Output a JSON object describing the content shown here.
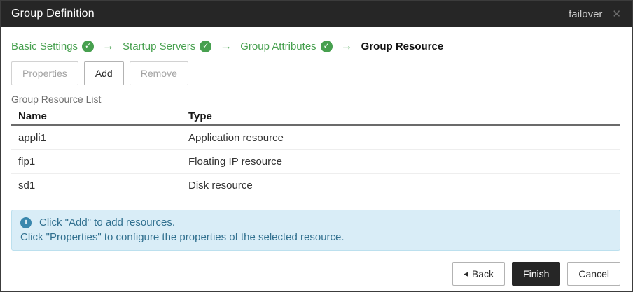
{
  "dialog": {
    "title": "Group Definition",
    "context_label": "failover",
    "close_glyph": "✕"
  },
  "wizard": {
    "check_glyph": "✓",
    "arrow_glyph": "→",
    "steps": [
      {
        "label": "Basic Settings",
        "completed": true,
        "current": false
      },
      {
        "label": "Startup Servers",
        "completed": true,
        "current": false
      },
      {
        "label": "Group Attributes",
        "completed": true,
        "current": false
      },
      {
        "label": "Group Resource",
        "completed": false,
        "current": true
      }
    ]
  },
  "toolbar": {
    "properties_label": "Properties",
    "add_label": "Add",
    "remove_label": "Remove"
  },
  "list": {
    "caption": "Group Resource List",
    "columns": {
      "name": "Name",
      "type": "Type"
    },
    "rows": [
      {
        "name": "appli1",
        "type": "Application resource"
      },
      {
        "name": "fip1",
        "type": "Floating IP resource"
      },
      {
        "name": "sd1",
        "type": "Disk resource"
      }
    ]
  },
  "info": {
    "icon_glyph": "i",
    "line1": "Click \"Add\" to add resources.",
    "line2": "Click \"Properties\" to configure the properties of the selected resource."
  },
  "footer": {
    "back_icon_glyph": "◀",
    "back_label": "Back",
    "finish_label": "Finish",
    "cancel_label": "Cancel"
  },
  "colors": {
    "titlebar_bg": "#262626",
    "accent_green": "#47a04f",
    "info_bg": "#d9edf7",
    "info_border": "#bce0ee",
    "info_text": "#31708f",
    "info_icon_bg": "#3a87ad",
    "primary_button_bg": "#262626"
  }
}
